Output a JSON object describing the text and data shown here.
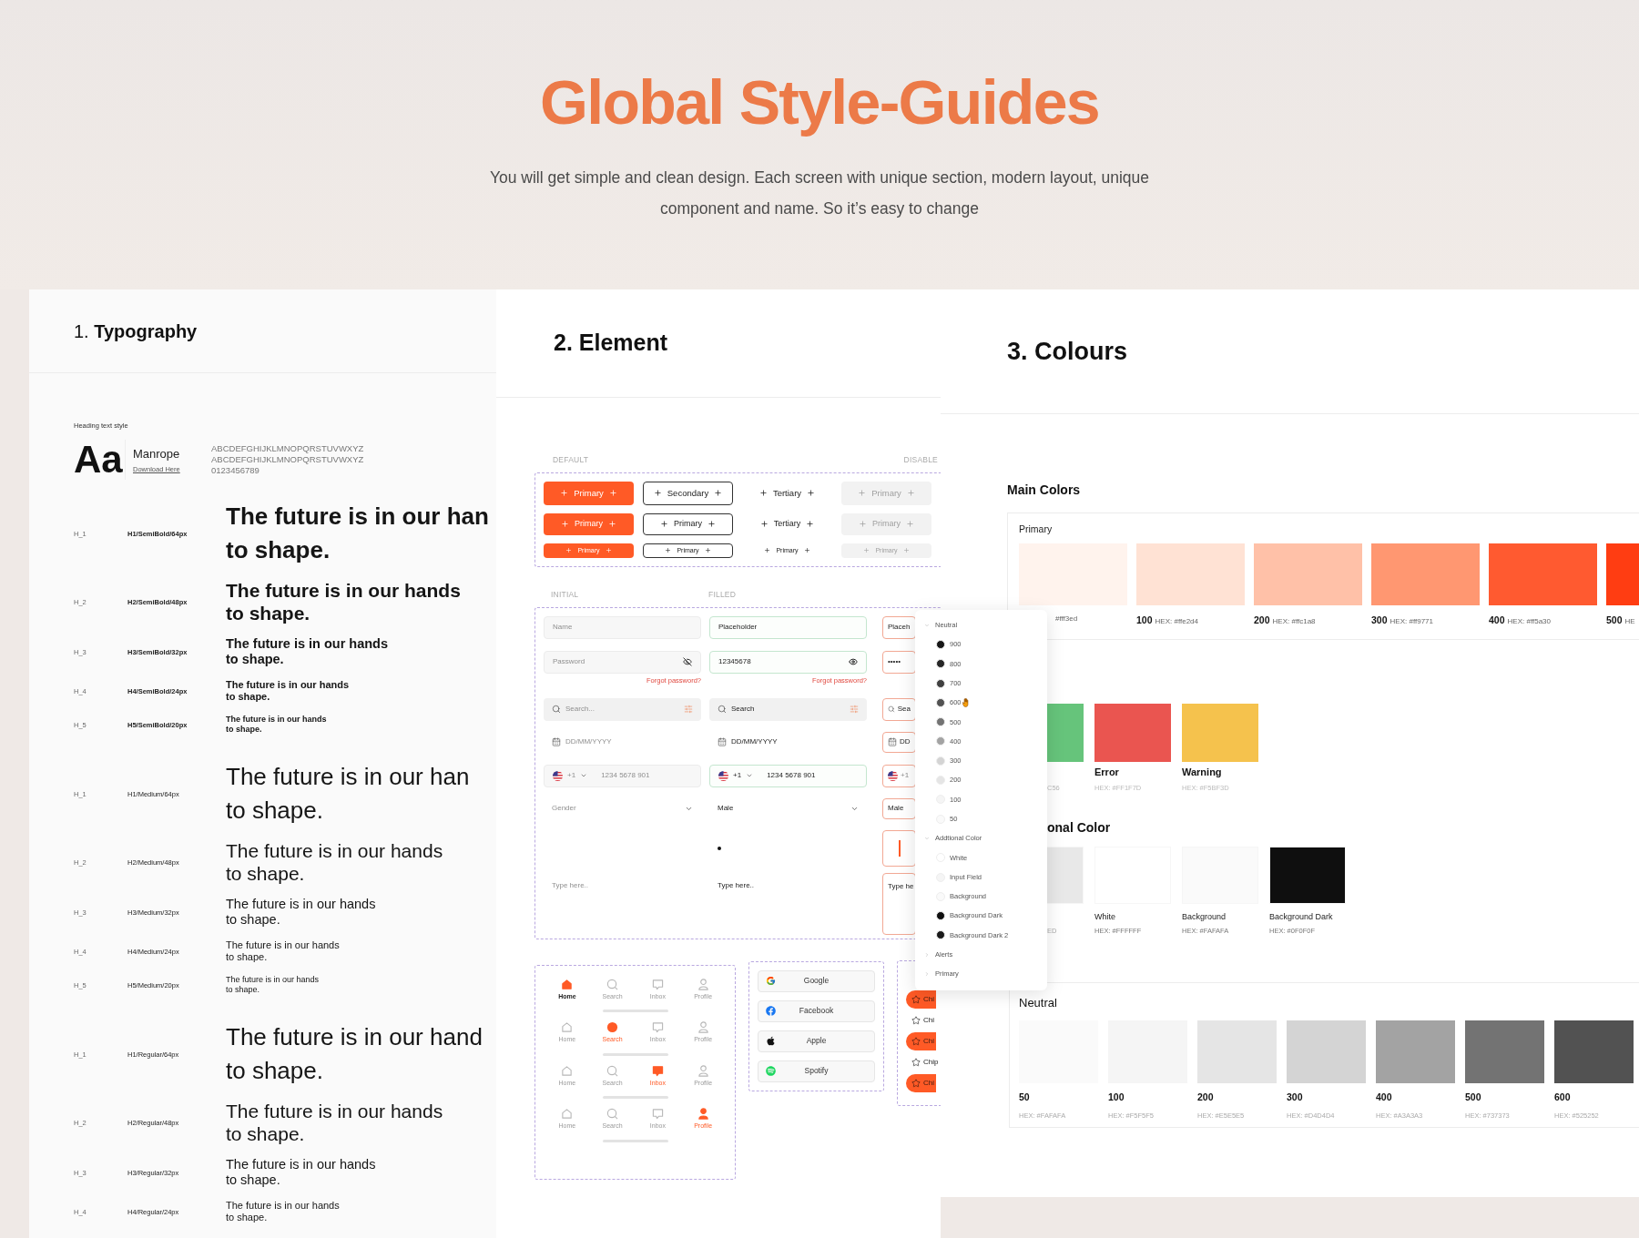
{
  "header": {
    "title": "Global Style-Guides",
    "subtitle": "You will get simple and clean design. Each screen with unique section, modern layout, unique component and name. So it’s easy to change"
  },
  "typography": {
    "title": "1. **Typography**",
    "section_label": "Heading text style",
    "specimen": "Aa",
    "font_name": "Manrope",
    "download_link": "Download Here",
    "glyphs": [
      "ABCDEFGHIJKLMNOPQRSTUVWXYZ",
      "ABCDEFGHIJKLMNOPQRSTUVWXYZ",
      "0123456789"
    ],
    "groups": [
      {
        "kind": "semibold",
        "rows": [
          {
            "level": "H_1",
            "style": "H1/SemiBold/64px",
            "sample": "The future is in our han\nto shape."
          },
          {
            "level": "H_2",
            "style": "H2/SemiBold/48px",
            "sample": "The future is in our hands\nto shape."
          },
          {
            "level": "H_3",
            "style": "H3/SemiBold/32px",
            "sample": "The future is in our hands\nto shape."
          },
          {
            "level": "H_4",
            "style": "H4/SemiBold/24px",
            "sample": "The future is in our hands\nto shape."
          },
          {
            "level": "H_5",
            "style": "H5/SemiBold/20px",
            "sample": "The future is in our hands\nto shape."
          }
        ]
      },
      {
        "kind": "medium",
        "rows": [
          {
            "level": "H_1",
            "style": "H1/Medium/64px",
            "sample": "The future is in our han\nto shape."
          },
          {
            "level": "H_2",
            "style": "H2/Medium/48px",
            "sample": "The future is in our hands\nto shape."
          },
          {
            "level": "H_3",
            "style": "H3/Medium/32px",
            "sample": "The future is in our hands\nto shape."
          },
          {
            "level": "H_4",
            "style": "H4/Medium/24px",
            "sample": "The future is in our hands\nto shape."
          },
          {
            "level": "H_5",
            "style": "H5/Medium/20px",
            "sample": "The future is in our hands\nto shape."
          }
        ]
      },
      {
        "kind": "regular",
        "rows": [
          {
            "level": "H_1",
            "style": "H1/Regular/64px",
            "sample": "The future is in our hand\nto shape."
          },
          {
            "level": "H_2",
            "style": "H2/Regular/48px",
            "sample": "The future is in our hands\nto shape."
          },
          {
            "level": "H_3",
            "style": "H3/Regular/32px",
            "sample": "The future is in our hands\nto shape."
          },
          {
            "level": "H_4",
            "style": "H4/Regular/24px",
            "sample": "The future is in our hands\nto shape."
          }
        ]
      }
    ]
  },
  "element": {
    "title": "2. Element",
    "button_headings": [
      "DEFAULT",
      "DISABLE"
    ],
    "button_rows": [
      [
        {
          "kind": "primary",
          "label": "Primary"
        },
        {
          "kind": "secondary",
          "label": "Secondary"
        },
        {
          "kind": "tertiary",
          "label": "Tertiary"
        },
        {
          "kind": "disabled",
          "label": "Primary"
        }
      ],
      [
        {
          "kind": "primary",
          "label": "Primary"
        },
        {
          "kind": "secondary",
          "label": "Primary"
        },
        {
          "kind": "tertiary",
          "label": "Tertiary"
        },
        {
          "kind": "disabled",
          "label": "Primary"
        }
      ],
      [
        {
          "kind": "primary",
          "label": "Primary"
        },
        {
          "kind": "secondary",
          "label": "Primary"
        },
        {
          "kind": "tertiary",
          "label": "Primary"
        },
        {
          "kind": "disabled",
          "label": "Primary"
        }
      ]
    ],
    "field_headings": [
      "INITIAL",
      "FILLED"
    ],
    "field_columns": [
      {
        "kind": "initial",
        "fields": [
          {
            "kind": "text",
            "placeholder": "Name"
          },
          {
            "kind": "password",
            "placeholder": "Password",
            "link": "Forgot password?"
          },
          {
            "kind": "search",
            "placeholder": "Search..."
          },
          {
            "kind": "date",
            "placeholder": "DD/MM/YYYY"
          },
          {
            "kind": "phone",
            "code": "+1",
            "placeholder": "1234 5678 901"
          },
          {
            "kind": "select",
            "placeholder": "Gender"
          },
          {
            "kind": "cursor"
          },
          {
            "kind": "textarea",
            "placeholder": "Type here.."
          }
        ]
      },
      {
        "kind": "filled",
        "fields": [
          {
            "kind": "text",
            "value": "Placeholder"
          },
          {
            "kind": "password",
            "value": "12345678",
            "link": "Forgot password?"
          },
          {
            "kind": "search",
            "value": "Search"
          },
          {
            "kind": "date",
            "value": "DD/MM/YYYY"
          },
          {
            "kind": "phone",
            "code": "+1",
            "value": "1234 5678 901"
          },
          {
            "kind": "select",
            "value": "Male"
          },
          {
            "kind": "cursor"
          },
          {
            "kind": "textarea",
            "value": "Type here.."
          }
        ]
      },
      {
        "kind": "error",
        "fields": [
          {
            "kind": "text",
            "value": "Placeh"
          },
          {
            "kind": "password",
            "value": "•••••"
          },
          {
            "kind": "search",
            "value": "Sea"
          },
          {
            "kind": "date",
            "value": "DD"
          },
          {
            "kind": "phone",
            "code": "+1"
          },
          {
            "kind": "select",
            "value": "Male"
          },
          {
            "kind": "cursor"
          },
          {
            "kind": "textarea",
            "value": "Type he"
          }
        ]
      }
    ],
    "nav_rows": [
      [
        {
          "kind": "home",
          "label": "Home",
          "selected": true
        },
        {
          "kind": "search",
          "label": "Search",
          "selected": false
        },
        {
          "kind": "inbox",
          "label": "Inbox",
          "selected": false
        },
        {
          "kind": "profile",
          "label": "Profile",
          "selected": false
        }
      ],
      [
        {
          "kind": "home",
          "label": "Home",
          "selected": false
        },
        {
          "kind": "search",
          "label": "Search",
          "selected": true
        },
        {
          "kind": "inbox",
          "label": "Inbox",
          "selected": false
        },
        {
          "kind": "profile",
          "label": "Profile",
          "selected": false
        }
      ],
      [
        {
          "kind": "home",
          "label": "Home",
          "selected": false
        },
        {
          "kind": "search",
          "label": "Search",
          "selected": false
        },
        {
          "kind": "inbox",
          "label": "Inbox",
          "selected": true
        },
        {
          "kind": "profile",
          "label": "Profile",
          "selected": false
        }
      ],
      [
        {
          "kind": "home",
          "label": "Home",
          "selected": false
        },
        {
          "kind": "search",
          "label": "Search",
          "selected": false
        },
        {
          "kind": "inbox",
          "label": "Inbox",
          "selected": false
        },
        {
          "kind": "profile",
          "label": "Profile",
          "selected": true
        }
      ]
    ],
    "social_buttons": [
      {
        "kind": "google",
        "label": "Google"
      },
      {
        "kind": "facebook",
        "label": "Facebook"
      },
      {
        "kind": "apple",
        "label": "Apple"
      },
      {
        "kind": "spotify",
        "label": "Spotify"
      }
    ],
    "chips": [
      {
        "label": "Chi",
        "selected": true
      },
      {
        "label": "Chi",
        "selected": false
      },
      {
        "label": "Chi",
        "selected": true
      },
      {
        "label": "Chip",
        "selected": false
      },
      {
        "label": "Chi",
        "selected": true
      }
    ]
  },
  "colours": {
    "title": "3. Colours",
    "main_heading": "Main Colors",
    "primary": {
      "title": "Primary",
      "swatches": [
        {
          "color": "#fff3ed",
          "hex": "#fff3ed"
        },
        {
          "color": "#ffe2d4",
          "number": "100",
          "hex": "HEX: #ffe2d4"
        },
        {
          "color": "#ffc1a8",
          "number": "200",
          "hex": "HEX: #ffc1a8"
        },
        {
          "color": "#ff9771",
          "number": "300",
          "hex": "HEX: #ff9771"
        },
        {
          "color": "#ff5a30",
          "number": "400",
          "hex": "HEX: #ff5a30"
        },
        {
          "color": "#ff3d12",
          "number": "500",
          "hex": "HE"
        }
      ]
    },
    "alerts": [
      {
        "color": "#66c47b",
        "hex": "C56"
      },
      {
        "color": "#ea5550",
        "name": "Error",
        "hex": "HEX: #FF1F7D"
      },
      {
        "color": "#f5c24d",
        "name": "Warning",
        "hex": "HEX: #F5BF3D"
      }
    ],
    "additional_heading": "onal Color",
    "additional": [
      {
        "color": "#e8e8e8",
        "hex": "ED"
      },
      {
        "color": "#ffffff",
        "name": "White",
        "hex": "HEX: #FFFFFF"
      },
      {
        "color": "#fafafa",
        "name": "Background",
        "hex": "HEX: #FAFAFA"
      },
      {
        "color": "#0f0f0f",
        "name": "Background Dark",
        "hex": "HEX: #0F0F0F"
      }
    ],
    "neutral": {
      "title": "Neutral",
      "swatches": [
        {
          "color": "#fafafa",
          "number": "50",
          "hex": "HEX: #FAFAFA"
        },
        {
          "color": "#f5f5f5",
          "number": "100",
          "hex": "HEX: #F5F5F5"
        },
        {
          "color": "#e5e5e5",
          "number": "200",
          "hex": "HEX: #E5E5E5"
        },
        {
          "color": "#d4d4d4",
          "number": "300",
          "hex": "HEX: #D4D4D4"
        },
        {
          "color": "#a3a3a3",
          "number": "400",
          "hex": "HEX: #A3A3A3"
        },
        {
          "color": "#737373",
          "number": "500",
          "hex": "HEX: #737373"
        },
        {
          "color": "#525252",
          "number": "600",
          "hex": "HEX: #525252"
        }
      ]
    }
  },
  "layers": [
    {
      "name": "Neutral",
      "expanded": true,
      "children": [
        {
          "name": "900",
          "color": "#171717",
          "hovered": false
        },
        {
          "name": "800",
          "color": "#262626",
          "hovered": false
        },
        {
          "name": "700",
          "color": "#404040",
          "hovered": false
        },
        {
          "name": "600",
          "color": "#525252",
          "hovered": true
        },
        {
          "name": "500",
          "color": "#737373",
          "hovered": false
        },
        {
          "name": "400",
          "color": "#a3a3a3",
          "hovered": false
        },
        {
          "name": "300",
          "color": "#d4d4d4",
          "hovered": false
        },
        {
          "name": "200",
          "color": "#e5e5e5",
          "hovered": false
        },
        {
          "name": "100",
          "color": "#f5f5f5",
          "hovered": false
        },
        {
          "name": "50",
          "color": "#fafafa",
          "hovered": false
        }
      ]
    },
    {
      "name": "Addtional Color",
      "expanded": true,
      "children": [
        {
          "name": "White",
          "color": "#ffffff",
          "hovered": false
        },
        {
          "name": "Input Field",
          "color": "#f5f5f5",
          "hovered": false
        },
        {
          "name": "Background",
          "color": "#fafafa",
          "hovered": false
        },
        {
          "name": "Background Dark",
          "color": "#0f0f0f",
          "hovered": false
        },
        {
          "name": "Background Dark 2",
          "color": "#1a1a1a",
          "hovered": false
        }
      ]
    },
    {
      "name": "Alerts",
      "expanded": false
    },
    {
      "name": "Primary",
      "expanded": false
    }
  ]
}
